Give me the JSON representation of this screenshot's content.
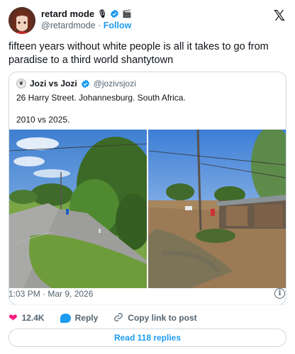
{
  "author": {
    "display_name": "retard mode",
    "emoji_a": "🎙",
    "emoji_b": "🎬",
    "handle": "@retardmode",
    "separator": "·",
    "follow_label": "Follow"
  },
  "tweet": {
    "text": "fifteen years without white people is all it takes to go from paradise to a third world shantytown",
    "timestamp": "1:03 PM · Mar 9, 2026"
  },
  "quote": {
    "avatar_glyph": "❦",
    "name": "Jozi vs Jozi",
    "handle": "@jozivsjozi",
    "line1": "26 Harry Street. Johannesburg. South Africa.",
    "line2": "2010 vs 2025."
  },
  "actions": {
    "likes": "12.4K",
    "reply_label": "Reply",
    "copy_label": "Copy link to post",
    "read_replies": "Read 118 replies"
  },
  "brand": {
    "x_logo": "𝕏",
    "info_glyph": "i",
    "heart": "❤",
    "link_glyph": "🔗"
  },
  "colors": {
    "accent": "#1d9bf0",
    "like": "#f91880",
    "muted": "#536471"
  }
}
